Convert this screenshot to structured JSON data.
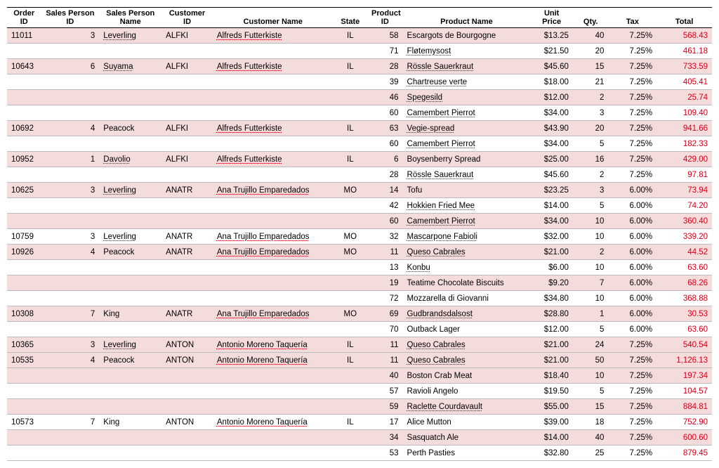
{
  "columns": [
    "Order ID",
    "Sales Person ID",
    "Sales Person Name",
    "Customer ID",
    "Customer Name",
    "State",
    "Product ID",
    "Product Name",
    "Unit Price",
    "Qty.",
    "Tax",
    "Total"
  ],
  "rows": [
    {
      "shade": true,
      "order": "11011",
      "spid": "3",
      "spname": "Leverling",
      "spu": true,
      "cid": "ALFKI",
      "cname": "Alfreds Futterkiste",
      "cnu": true,
      "state": "IL",
      "pid": "58",
      "pname": "Escargots de Bourgogne",
      "pnu": false,
      "price": "$13.25",
      "qty": "40",
      "tax": "7.25%",
      "total": "568.43"
    },
    {
      "shade": false,
      "order": "",
      "spid": "",
      "spname": "",
      "spu": false,
      "cid": "",
      "cname": "",
      "cnu": false,
      "state": "",
      "pid": "71",
      "pname": "Fløtemysost",
      "pnu": true,
      "price": "$21.50",
      "qty": "20",
      "tax": "7.25%",
      "total": "461.18"
    },
    {
      "shade": true,
      "order": "10643",
      "spid": "6",
      "spname": "Suyama",
      "spu": true,
      "cid": "ALFKI",
      "cname": "Alfreds Futterkiste",
      "cnu": true,
      "state": "IL",
      "pid": "28",
      "pname": "Rössle Sauerkraut",
      "pnu": true,
      "price": "$45.60",
      "qty": "15",
      "tax": "7.25%",
      "total": "733.59"
    },
    {
      "shade": false,
      "order": "",
      "spid": "",
      "spname": "",
      "spu": false,
      "cid": "",
      "cname": "",
      "cnu": false,
      "state": "",
      "pid": "39",
      "pname": "Chartreuse verte",
      "pnu": true,
      "price": "$18.00",
      "qty": "21",
      "tax": "7.25%",
      "total": "405.41"
    },
    {
      "shade": true,
      "order": "",
      "spid": "",
      "spname": "",
      "spu": false,
      "cid": "",
      "cname": "",
      "cnu": false,
      "state": "",
      "pid": "46",
      "pname": "Spegesild",
      "pnu": true,
      "price": "$12.00",
      "qty": "2",
      "tax": "7.25%",
      "total": "25.74"
    },
    {
      "shade": false,
      "order": "",
      "spid": "",
      "spname": "",
      "spu": false,
      "cid": "",
      "cname": "",
      "cnu": false,
      "state": "",
      "pid": "60",
      "pname": "Camembert Pierrot",
      "pnu": true,
      "price": "$34.00",
      "qty": "3",
      "tax": "7.25%",
      "total": "109.40"
    },
    {
      "shade": true,
      "order": "10692",
      "spid": "4",
      "spname": "Peacock",
      "spu": false,
      "cid": "ALFKI",
      "cname": "Alfreds Futterkiste",
      "cnu": true,
      "state": "IL",
      "pid": "63",
      "pname": "Vegie-spread",
      "pnu": true,
      "price": "$43.90",
      "qty": "20",
      "tax": "7.25%",
      "total": "941.66"
    },
    {
      "shade": false,
      "order": "",
      "spid": "",
      "spname": "",
      "spu": false,
      "cid": "",
      "cname": "",
      "cnu": false,
      "state": "",
      "pid": "60",
      "pname": "Camembert Pierrot",
      "pnu": true,
      "price": "$34.00",
      "qty": "5",
      "tax": "7.25%",
      "total": "182.33"
    },
    {
      "shade": true,
      "order": "10952",
      "spid": "1",
      "spname": "Davolio",
      "spu": true,
      "cid": "ALFKI",
      "cname": "Alfreds Futterkiste",
      "cnu": true,
      "state": "IL",
      "pid": "6",
      "pname": "Boysenberry Spread",
      "pnu": false,
      "price": "$25.00",
      "qty": "16",
      "tax": "7.25%",
      "total": "429.00"
    },
    {
      "shade": false,
      "order": "",
      "spid": "",
      "spname": "",
      "spu": false,
      "cid": "",
      "cname": "",
      "cnu": false,
      "state": "",
      "pid": "28",
      "pname": "Rössle Sauerkraut",
      "pnu": true,
      "price": "$45.60",
      "qty": "2",
      "tax": "7.25%",
      "total": "97.81"
    },
    {
      "shade": true,
      "order": "10625",
      "spid": "3",
      "spname": "Leverling",
      "spu": true,
      "cid": "ANATR",
      "cname": "Ana Trujillo Emparedados",
      "cnu": true,
      "state": "MO",
      "pid": "14",
      "pname": "Tofu",
      "pnu": false,
      "price": "$23.25",
      "qty": "3",
      "tax": "6.00%",
      "total": "73.94"
    },
    {
      "shade": false,
      "order": "",
      "spid": "",
      "spname": "",
      "spu": false,
      "cid": "",
      "cname": "",
      "cnu": false,
      "state": "",
      "pid": "42",
      "pname": "Hokkien Fried Mee",
      "pnu": true,
      "price": "$14.00",
      "qty": "5",
      "tax": "6.00%",
      "total": "74.20"
    },
    {
      "shade": true,
      "order": "",
      "spid": "",
      "spname": "",
      "spu": false,
      "cid": "",
      "cname": "",
      "cnu": false,
      "state": "",
      "pid": "60",
      "pname": "Camembert Pierrot",
      "pnu": true,
      "price": "$34.00",
      "qty": "10",
      "tax": "6.00%",
      "total": "360.40"
    },
    {
      "shade": false,
      "order": "10759",
      "spid": "3",
      "spname": "Leverling",
      "spu": true,
      "cid": "ANATR",
      "cname": "Ana Trujillo Emparedados",
      "cnu": true,
      "state": "MO",
      "pid": "32",
      "pname": "Mascarpone Fabioli",
      "pnu": true,
      "price": "$32.00",
      "qty": "10",
      "tax": "6.00%",
      "total": "339.20"
    },
    {
      "shade": true,
      "order": "10926",
      "spid": "4",
      "spname": "Peacock",
      "spu": false,
      "cid": "ANATR",
      "cname": "Ana Trujillo Emparedados",
      "cnu": true,
      "state": "MO",
      "pid": "11",
      "pname": "Queso Cabrales",
      "pnu": true,
      "price": "$21.00",
      "qty": "2",
      "tax": "6.00%",
      "total": "44.52"
    },
    {
      "shade": false,
      "order": "",
      "spid": "",
      "spname": "",
      "spu": false,
      "cid": "",
      "cname": "",
      "cnu": false,
      "state": "",
      "pid": "13",
      "pname": "Konbu",
      "pnu": true,
      "price": "$6.00",
      "qty": "10",
      "tax": "6.00%",
      "total": "63.60"
    },
    {
      "shade": true,
      "order": "",
      "spid": "",
      "spname": "",
      "spu": false,
      "cid": "",
      "cname": "",
      "cnu": false,
      "state": "",
      "pid": "19",
      "pname": "Teatime Chocolate Biscuits",
      "pnu": false,
      "price": "$9.20",
      "qty": "7",
      "tax": "6.00%",
      "total": "68.26"
    },
    {
      "shade": false,
      "order": "",
      "spid": "",
      "spname": "",
      "spu": false,
      "cid": "",
      "cname": "",
      "cnu": false,
      "state": "",
      "pid": "72",
      "pname": "Mozzarella di Giovanni",
      "pnu": false,
      "price": "$34.80",
      "qty": "10",
      "tax": "6.00%",
      "total": "368.88"
    },
    {
      "shade": true,
      "order": "10308",
      "spid": "7",
      "spname": "King",
      "spu": false,
      "cid": "ANATR",
      "cname": "Ana Trujillo Emparedados",
      "cnu": true,
      "state": "MO",
      "pid": "69",
      "pname": "Gudbrandsdalsost",
      "pnu": true,
      "price": "$28.80",
      "qty": "1",
      "tax": "6.00%",
      "total": "30.53"
    },
    {
      "shade": false,
      "order": "",
      "spid": "",
      "spname": "",
      "spu": false,
      "cid": "",
      "cname": "",
      "cnu": false,
      "state": "",
      "pid": "70",
      "pname": "Outback Lager",
      "pnu": false,
      "price": "$12.00",
      "qty": "5",
      "tax": "6.00%",
      "total": "63.60"
    },
    {
      "shade": true,
      "order": "10365",
      "spid": "3",
      "spname": "Leverling",
      "spu": true,
      "cid": "ANTON",
      "cname": "Antonio Moreno Taquería",
      "cnu": true,
      "state": "IL",
      "pid": "11",
      "pname": "Queso Cabrales",
      "pnu": true,
      "price": "$21.00",
      "qty": "24",
      "tax": "7.25%",
      "total": "540.54"
    },
    {
      "shade": true,
      "order": "10535",
      "spid": "4",
      "spname": "Peacock",
      "spu": false,
      "cid": "ANTON",
      "cname": "Antonio Moreno Taquería",
      "cnu": true,
      "state": "IL",
      "pid": "11",
      "pname": "Queso Cabrales",
      "pnu": true,
      "price": "$21.00",
      "qty": "50",
      "tax": "7.25%",
      "total": "1,126.13"
    },
    {
      "shade": true,
      "order": "",
      "spid": "",
      "spname": "",
      "spu": false,
      "cid": "",
      "cname": "",
      "cnu": false,
      "state": "",
      "pid": "40",
      "pname": "Boston Crab Meat",
      "pnu": false,
      "price": "$18.40",
      "qty": "10",
      "tax": "7.25%",
      "total": "197.34"
    },
    {
      "shade": false,
      "order": "",
      "spid": "",
      "spname": "",
      "spu": false,
      "cid": "",
      "cname": "",
      "cnu": false,
      "state": "",
      "pid": "57",
      "pname": "Ravioli Angelo",
      "pnu": false,
      "price": "$19.50",
      "qty": "5",
      "tax": "7.25%",
      "total": "104.57"
    },
    {
      "shade": true,
      "order": "",
      "spid": "",
      "spname": "",
      "spu": false,
      "cid": "",
      "cname": "",
      "cnu": false,
      "state": "",
      "pid": "59",
      "pname": "Raclette Courdavault",
      "pnu": true,
      "price": "$55.00",
      "qty": "15",
      "tax": "7.25%",
      "total": "884.81"
    },
    {
      "shade": false,
      "order": "10573",
      "spid": "7",
      "spname": "King",
      "spu": false,
      "cid": "ANTON",
      "cname": "Antonio Moreno Taquería",
      "cnu": true,
      "state": "IL",
      "pid": "17",
      "pname": "Alice Mutton",
      "pnu": false,
      "price": "$39.00",
      "qty": "18",
      "tax": "7.25%",
      "total": "752.90"
    },
    {
      "shade": true,
      "order": "",
      "spid": "",
      "spname": "",
      "spu": false,
      "cid": "",
      "cname": "",
      "cnu": false,
      "state": "",
      "pid": "34",
      "pname": "Sasquatch Ale",
      "pnu": false,
      "price": "$14.00",
      "qty": "40",
      "tax": "7.25%",
      "total": "600.60"
    },
    {
      "shade": false,
      "order": "",
      "spid": "",
      "spname": "",
      "spu": false,
      "cid": "",
      "cname": "",
      "cnu": false,
      "state": "",
      "pid": "53",
      "pname": "Perth Pasties",
      "pnu": false,
      "price": "$32.80",
      "qty": "25",
      "tax": "7.25%",
      "total": "879.45"
    }
  ]
}
